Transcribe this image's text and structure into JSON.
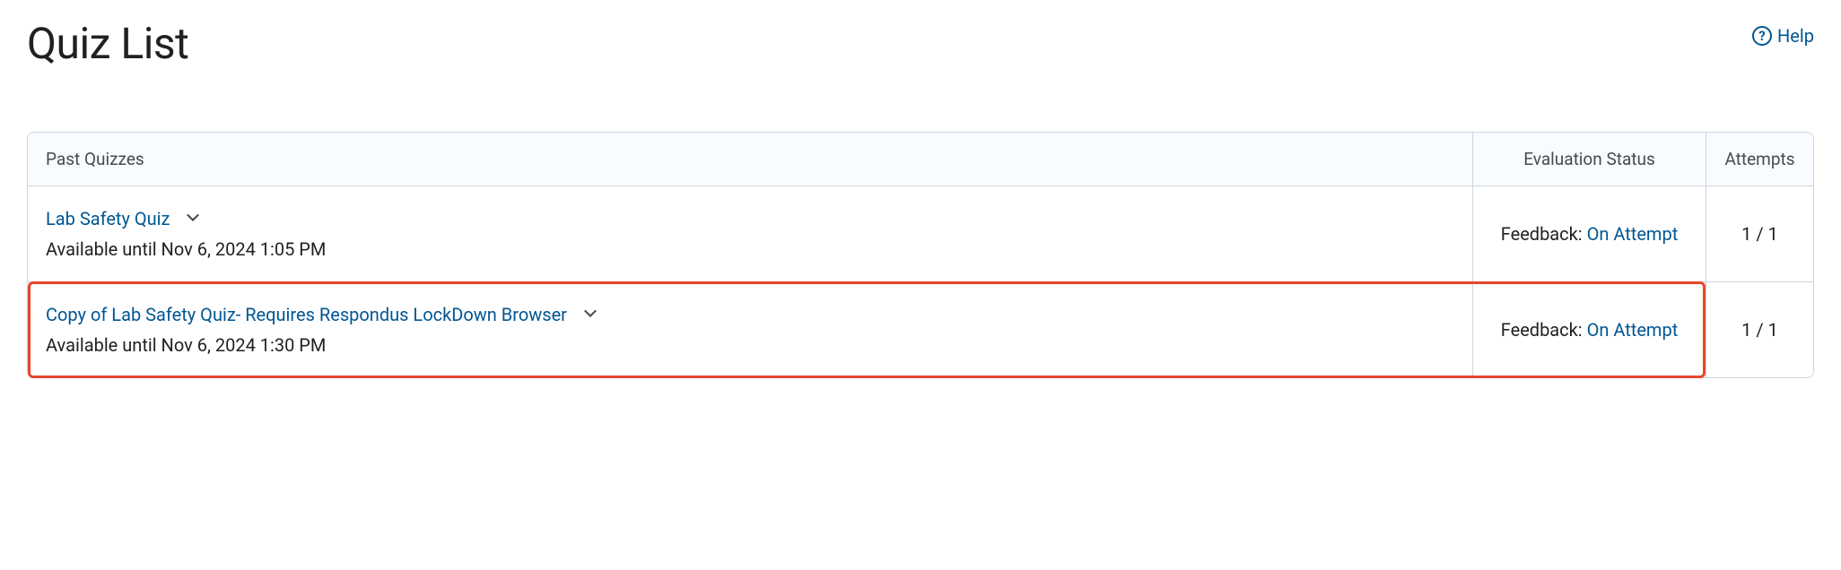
{
  "header": {
    "title": "Quiz List",
    "help_label": "Help"
  },
  "table": {
    "headers": {
      "name": "Past Quizzes",
      "eval": "Evaluation Status",
      "attempts": "Attempts"
    },
    "rows": [
      {
        "title": "Lab Safety Quiz",
        "availability": "Available until Nov 6, 2024 1:05 PM",
        "feedback_prefix": "Feedback: ",
        "feedback_link": "On Attempt",
        "attempts": "1 / 1"
      },
      {
        "title": "Copy of Lab Safety Quiz- Requires Respondus LockDown Browser",
        "availability": "Available until Nov 6, 2024 1:30 PM",
        "feedback_prefix": "Feedback: ",
        "feedback_link": "On Attempt",
        "attempts": "1 / 1"
      }
    ]
  }
}
